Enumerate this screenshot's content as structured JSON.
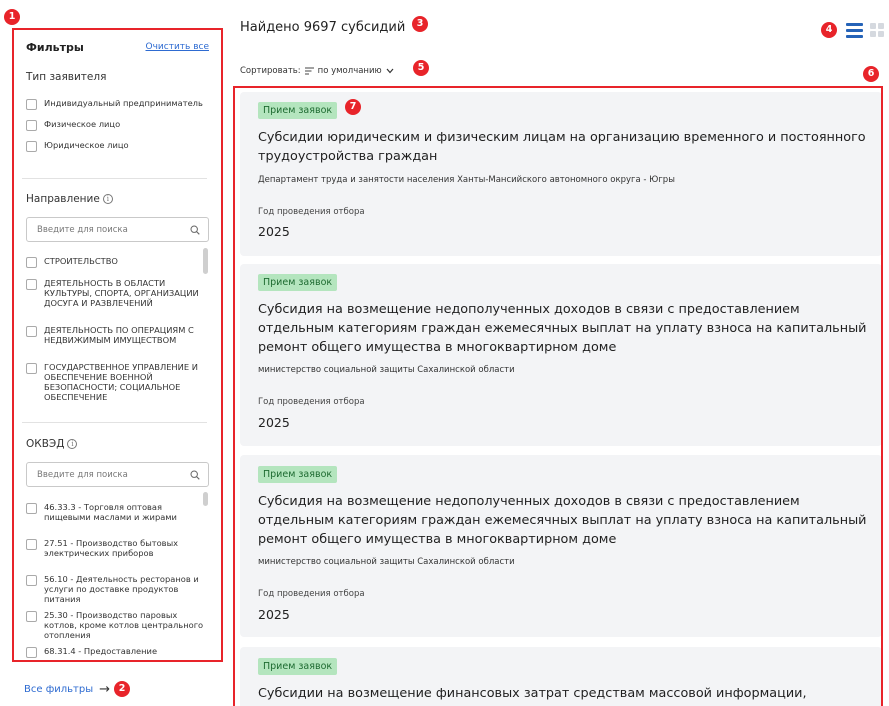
{
  "sidebar": {
    "title": "Фильтры",
    "clear_all": "Очистить все",
    "applicant_type": {
      "title": "Тип заявителя",
      "options": [
        "Индивидуальный предприниматель",
        "Физическое лицо",
        "Юридическое лицо"
      ]
    },
    "direction": {
      "title": "Направление",
      "search_placeholder": "Введите для поиска",
      "options": [
        "СТРОИТЕЛЬСТВО",
        "ДЕЯТЕЛЬНОСТЬ В ОБЛАСТИ КУЛЬТУРЫ, СПОРТА, ОРГАНИЗАЦИИ ДОСУГА И РАЗВЛЕЧЕНИЙ",
        "ДЕЯТЕЛЬНОСТЬ ПО ОПЕРАЦИЯМ С НЕДВИЖИМЫМ ИМУЩЕСТВОМ",
        "ГОСУДАРСТВЕННОЕ УПРАВЛЕНИЕ И ОБЕСПЕЧЕНИЕ ВОЕННОЙ БЕЗОПАСНОСТИ; СОЦИАЛЬНОЕ ОБЕСПЕЧЕНИЕ"
      ]
    },
    "okved": {
      "title": "ОКВЭД",
      "search_placeholder": "Введите для поиска",
      "options": [
        "46.33.3 - Торговля оптовая пищевыми маслами и жирами",
        "27.51 - Производство бытовых электрических приборов",
        "56.10 - Деятельность ресторанов и услуги по доставке продуктов питания",
        "25.30 - Производство паровых котлов, кроме котлов центрального отопления",
        "68.31.4 - Предоставление"
      ]
    },
    "all_filters": "Все фильтры"
  },
  "header": {
    "found_text": "Найдено 9697 субсидий",
    "sort_label": "Сортировать:",
    "sort_value": "по умолчанию"
  },
  "results": [
    {
      "status": "Прием заявок",
      "title": "Субсидии юридическим и физическим лицам на организацию временного и постоянного трудоустройства граждан",
      "org": "Департамент труда и занятости населения Ханты-Мансийского автономного округа - Югры",
      "year_label": "Год проведения отбора",
      "year": "2025"
    },
    {
      "status": "Прием заявок",
      "title": "Субсидия на возмещение недополученных доходов в связи с предоставлением отдельным категориям граждан ежемесячных выплат на уплату взноса на капитальный ремонт общего имущества в многоквартирном доме",
      "org": "министерство социальной защиты Сахалинской области",
      "year_label": "Год проведения отбора",
      "year": "2025"
    },
    {
      "status": "Прием заявок",
      "title": "Субсидия на возмещение недополученных доходов в связи с предоставлением отдельным категориям граждан ежемесячных выплат на уплату взноса на капитальный ремонт общего имущества в многоквартирном доме",
      "org": "министерство социальной защиты Сахалинской области",
      "year_label": "Год проведения отбора",
      "year": "2025"
    },
    {
      "status": "Прием заявок",
      "title": "Субсидии на возмещение финансовых затрат средствам массовой информации,"
    }
  ],
  "annotations": [
    "1",
    "2",
    "3",
    "4",
    "5",
    "6",
    "7"
  ],
  "colors": {
    "annotation_red": "#e8242a",
    "link_blue": "#2e6bd1",
    "status_green_bg": "#b4e5be",
    "status_green_text": "#1e6b31",
    "card_bg": "#f3f4f6"
  }
}
